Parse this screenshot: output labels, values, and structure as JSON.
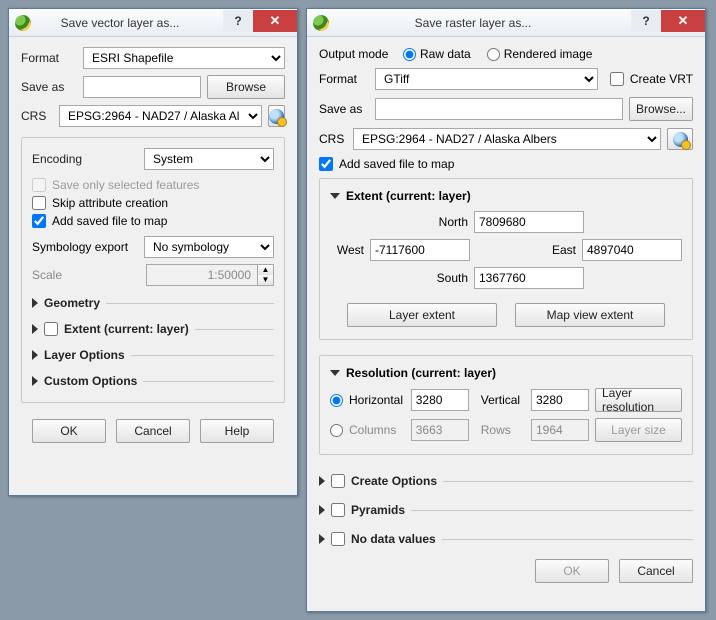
{
  "vector": {
    "title": "Save vector layer as...",
    "format_label": "Format",
    "format_value": "ESRI Shapefile",
    "saveas_label": "Save as",
    "saveas_value": "",
    "browse": "Browse",
    "crs_label": "CRS",
    "crs_value": "EPSG:2964 - NAD27 / Alaska Al",
    "encoding_label": "Encoding",
    "encoding_value": "System",
    "save_selected": "Save only selected features",
    "skip_attr": "Skip attribute creation",
    "add_saved": "Add saved file to map",
    "symb_label": "Symbology export",
    "symb_value": "No symbology",
    "scale_label": "Scale",
    "scale_value": "1:50000",
    "geom": "Geometry",
    "extent": "Extent (current: layer)",
    "layer_opts": "Layer Options",
    "custom_opts": "Custom Options",
    "ok": "OK",
    "cancel": "Cancel",
    "help": "Help"
  },
  "raster": {
    "title": "Save raster layer as...",
    "output_mode": "Output mode",
    "raw": "Raw data",
    "rendered": "Rendered image",
    "format_label": "Format",
    "format_value": "GTiff",
    "create_vrt": "Create VRT",
    "saveas_label": "Save as",
    "saveas_value": "",
    "browse": "Browse...",
    "crs_label": "CRS",
    "crs_value": "EPSG:2964 - NAD27 / Alaska Albers",
    "add_saved": "Add saved file to map",
    "extent_head": "Extent (current: layer)",
    "north": "North",
    "north_v": "7809680",
    "west": "West",
    "west_v": "-7117600",
    "east": "East",
    "east_v": "4897040",
    "south": "South",
    "south_v": "1367760",
    "layer_extent_btn": "Layer extent",
    "map_view_btn": "Map view extent",
    "res_head": "Resolution (current: layer)",
    "horiz": "Horizontal",
    "horiz_v": "3280",
    "vert": "Vertical",
    "vert_v": "3280",
    "cols": "Columns",
    "cols_v": "3663",
    "rows": "Rows",
    "rows_v": "1964",
    "layer_res_btn": "Layer resolution",
    "layer_size_btn": "Layer size",
    "create_opts": "Create Options",
    "pyramids": "Pyramids",
    "nodata": "No data values",
    "ok": "OK",
    "cancel": "Cancel"
  }
}
